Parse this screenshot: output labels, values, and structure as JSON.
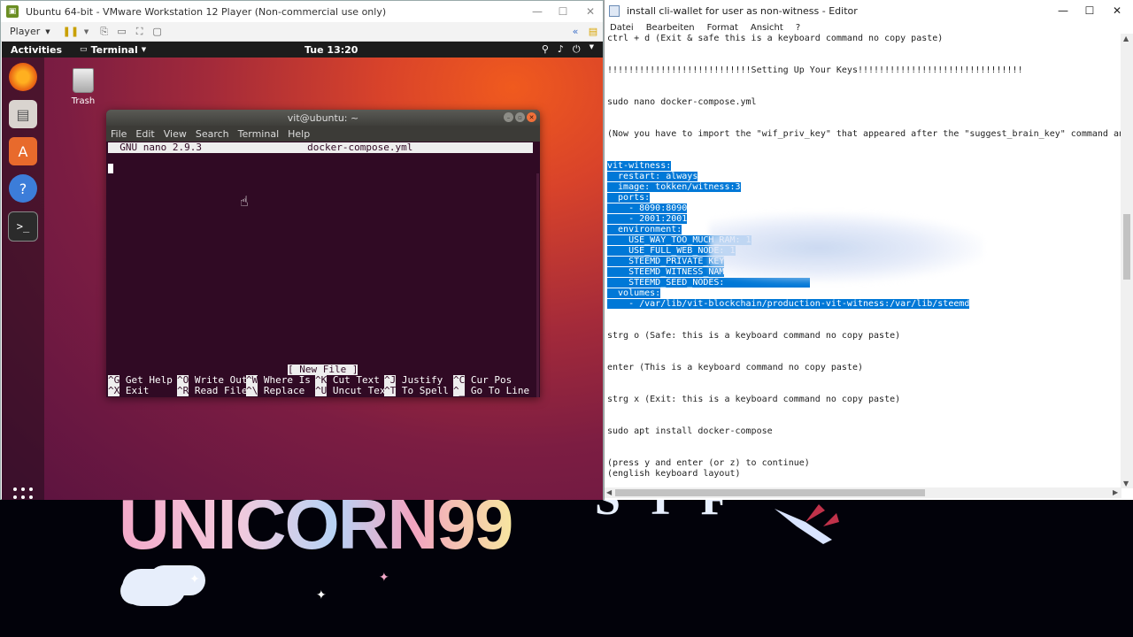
{
  "vmware": {
    "title": "Ubuntu 64-bit - VMware Workstation 12 Player (Non-commercial use only)",
    "player_menu": "Player",
    "window_controls": [
      "—",
      "☐",
      "✕"
    ]
  },
  "ubuntu": {
    "topbar": {
      "activities": "Activities",
      "app_menu": "Terminal",
      "clock": "Tue 13:20"
    },
    "desktop_icons": {
      "trash_label": "Trash"
    }
  },
  "terminal": {
    "title": "vit@ubuntu: ~",
    "menu": [
      "File",
      "Edit",
      "View",
      "Search",
      "Terminal",
      "Help"
    ],
    "nano_header": "  GNU nano 2.9.3                  docker-compose.yml",
    "status": "[ New File ]",
    "shortcuts": [
      {
        "key": "^G",
        "label": " Get Help"
      },
      {
        "key": "^O",
        "label": " Write Out"
      },
      {
        "key": "^W",
        "label": " Where Is"
      },
      {
        "key": "^K",
        "label": " Cut Text"
      },
      {
        "key": "^J",
        "label": " Justify"
      },
      {
        "key": "^C",
        "label": " Cur Pos"
      },
      {
        "key": "^X",
        "label": " Exit"
      },
      {
        "key": "^R",
        "label": " Read File"
      },
      {
        "key": "^\\",
        "label": " Replace"
      },
      {
        "key": "^U",
        "label": " Uncut Text"
      },
      {
        "key": "^T",
        "label": " To Spell"
      },
      {
        "key": "^_",
        "label": " Go To Line"
      }
    ]
  },
  "notepad": {
    "title": "install cli-wallet for user as non-witness - Editor",
    "menu": [
      "Datei",
      "Bearbeiten",
      "Format",
      "Ansicht",
      "?"
    ],
    "lines": [
      {
        "text": "ctrl + d (Exit & safe this is a keyboard command no copy paste)",
        "sel": false
      },
      {
        "text": "",
        "sel": false
      },
      {
        "text": "",
        "sel": false
      },
      {
        "text": "!!!!!!!!!!!!!!!!!!!!!!!!!!!Setting Up Your Keys!!!!!!!!!!!!!!!!!!!!!!!!!!!!!!!",
        "sel": false
      },
      {
        "text": "",
        "sel": false
      },
      {
        "text": "",
        "sel": false
      },
      {
        "text": "sudo nano docker-compose.yml",
        "sel": false
      },
      {
        "text": "",
        "sel": false
      },
      {
        "text": "",
        "sel": false
      },
      {
        "text": "(Now you have to import the \"wif_priv_key\" that appeared after the \"suggest_brain_key\" command and your vit u",
        "sel": false
      },
      {
        "text": "",
        "sel": false
      },
      {
        "text": "",
        "sel": false
      },
      {
        "text": "vit-witness:",
        "sel": true
      },
      {
        "text": "  restart: always",
        "sel": true
      },
      {
        "text": "  image: tokken/witness:3",
        "sel": true
      },
      {
        "text": "  ports:",
        "sel": true
      },
      {
        "text": "    - 8090:8090",
        "sel": true
      },
      {
        "text": "    - 2001:2001",
        "sel": true
      },
      {
        "text": "  environment:",
        "sel": true
      },
      {
        "text": "    USE_WAY_TOO_MUCH_RAM: 1",
        "sel": true
      },
      {
        "text": "    USE_FULL_WEB_NODE: 1",
        "sel": true
      },
      {
        "text": "    STEEMD_PRIVATE_KEY",
        "sel": true
      },
      {
        "text": "    STEEMD_WITNESS_NAM",
        "sel": true
      },
      {
        "text": "    STEEMD_SEED_NODES:                ",
        "sel": true
      },
      {
        "text": "  volumes:",
        "sel": true
      },
      {
        "text": "    - /var/lib/vit-blockchain/production-vit-witness:/var/lib/steemd",
        "sel": true
      },
      {
        "text": "",
        "sel": false
      },
      {
        "text": "",
        "sel": false
      },
      {
        "text": "strg o (Safe: this is a keyboard command no copy paste)",
        "sel": false
      },
      {
        "text": "",
        "sel": false
      },
      {
        "text": "",
        "sel": false
      },
      {
        "text": "enter (This is a keyboard command no copy paste)",
        "sel": false
      },
      {
        "text": "",
        "sel": false
      },
      {
        "text": "",
        "sel": false
      },
      {
        "text": "strg x (Exit: this is a keyboard command no copy paste)",
        "sel": false
      },
      {
        "text": "",
        "sel": false
      },
      {
        "text": "",
        "sel": false
      },
      {
        "text": "sudo apt install docker-compose",
        "sel": false
      },
      {
        "text": "",
        "sel": false
      },
      {
        "text": "",
        "sel": false
      },
      {
        "text": "(press y and enter (or z) to continue)",
        "sel": false
      },
      {
        "text": "(english keyboard layout)",
        "sel": false
      }
    ]
  },
  "banner": {
    "logo_text": "UNICORN99",
    "right_text": "STF"
  }
}
